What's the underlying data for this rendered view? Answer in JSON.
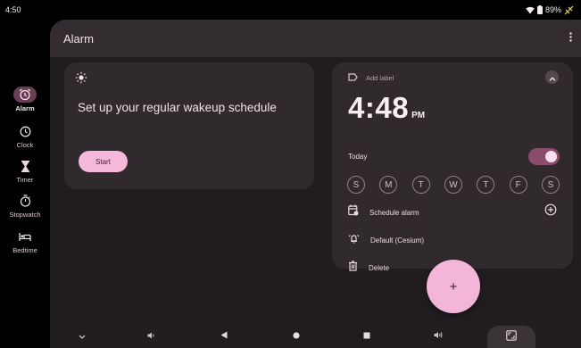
{
  "status_bar": {
    "time": "4:50",
    "battery_percent": "89%",
    "icons": [
      "wifi-icon",
      "battery-icon",
      "battery-saver-icon"
    ]
  },
  "nav_rail": {
    "items": [
      {
        "label": "Alarm",
        "icon": "alarm-icon",
        "active": true
      },
      {
        "label": "Clock",
        "icon": "clock-icon",
        "active": false
      },
      {
        "label": "Timer",
        "icon": "hourglass-icon",
        "active": false
      },
      {
        "label": "Stopwatch",
        "icon": "stopwatch-icon",
        "active": false
      },
      {
        "label": "Bedtime",
        "icon": "bed-icon",
        "active": false
      }
    ]
  },
  "app_bar": {
    "title": "Alarm",
    "menu_icon": "more-vert-icon"
  },
  "wakeup_card": {
    "icon": "sun-icon",
    "heading": "Set up your regular wakeup schedule",
    "start_label": "Start"
  },
  "alarm_card": {
    "add_label": "Add label",
    "time": "4:48",
    "ampm": "PM",
    "repeat_text": "Today",
    "enabled": true,
    "days": [
      "S",
      "M",
      "T",
      "W",
      "T",
      "F",
      "S"
    ],
    "schedule_label": "Schedule alarm",
    "ringtone_label": "Default (Cesium)",
    "delete_label": "Delete"
  },
  "fab": {
    "label": "+"
  },
  "system_nav": {
    "icons": [
      "chevron-down-icon",
      "volume-down-icon",
      "back-icon",
      "home-icon",
      "recents-icon",
      "volume-up-icon",
      "screenshot-icon"
    ]
  },
  "colors": {
    "surface": "#201c1f",
    "card": "#302a2e",
    "accent_pink": "#f3b6d8",
    "toggle_track": "#8a4c6b"
  }
}
